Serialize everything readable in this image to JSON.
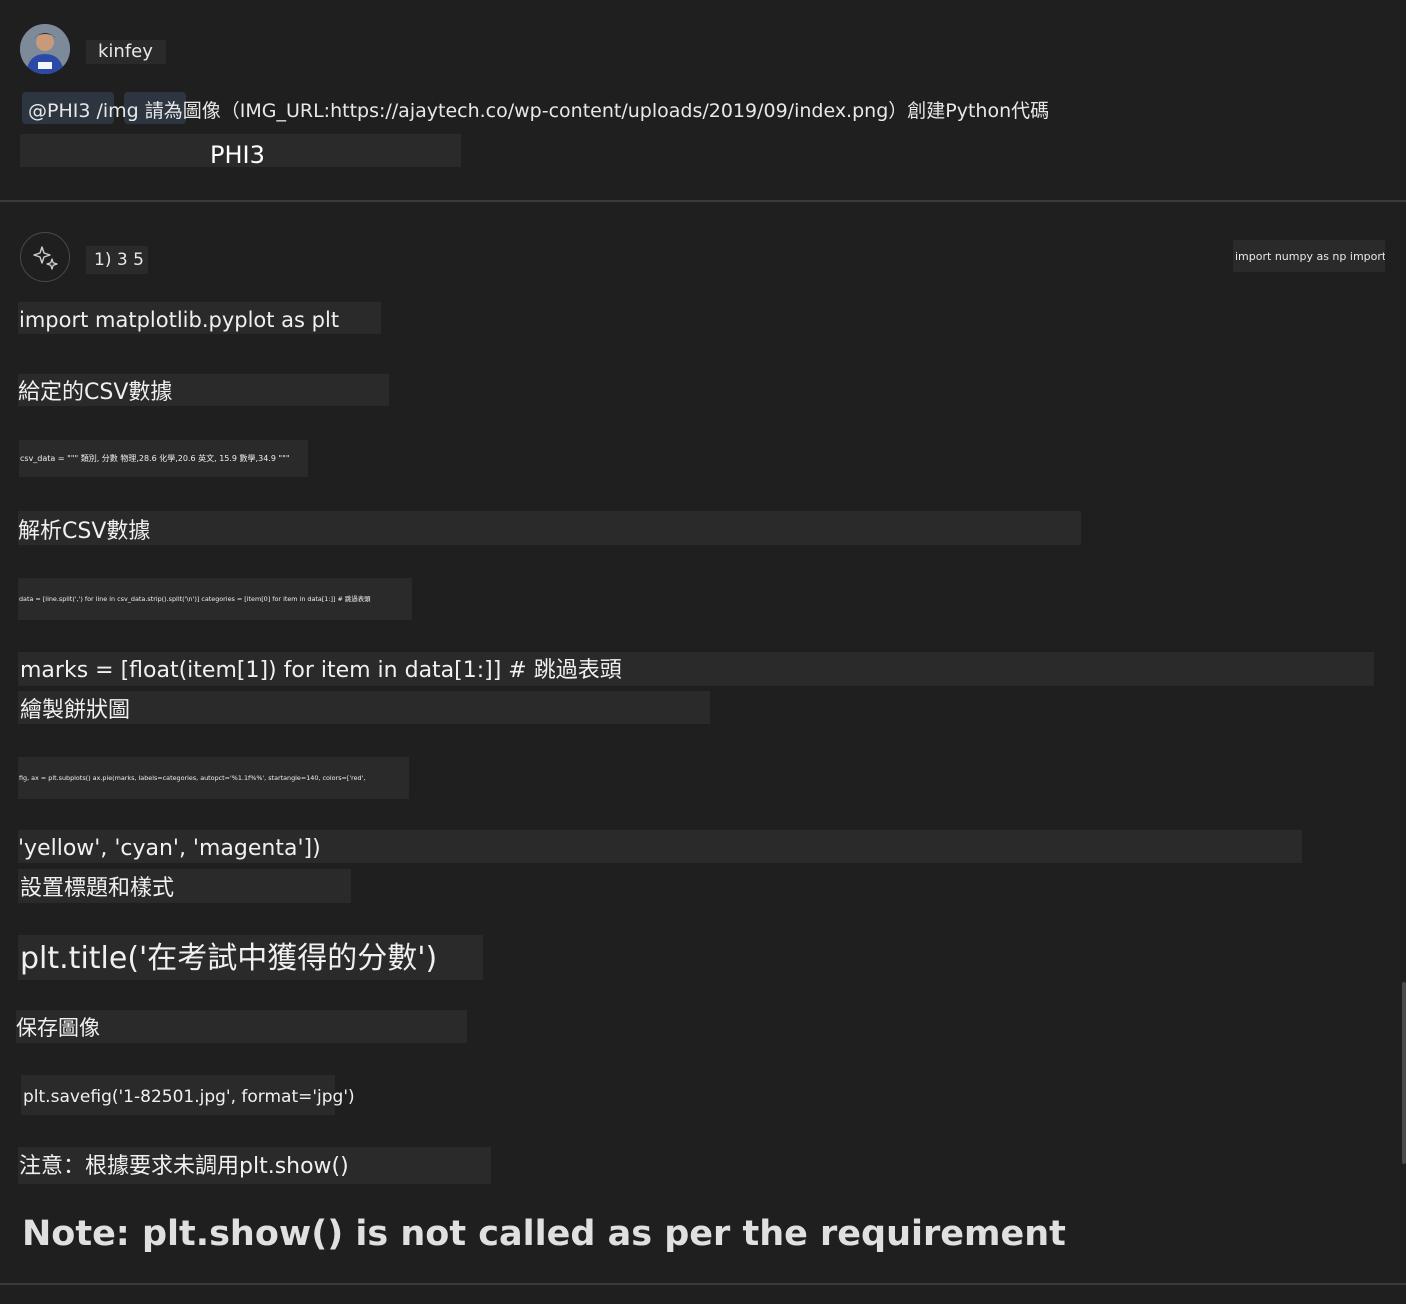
{
  "user": {
    "name": "kinfey",
    "prompt": "@PHI3 /img 請為圖像（IMG_URL:https://ajaytech.co/wp-content/uploads/2019/09/index.png）創建Python代碼",
    "agent": "PHI3"
  },
  "response": {
    "header_label": "1) 3 5",
    "side_snippet": "import numpy as np import io",
    "lines": {
      "import_plt": "import matplotlib.pyplot as plt",
      "given_csv": "給定的CSV數據",
      "csv_data": "csv_data = \"\"\" 類別, 分數 物理,28.6 化學,20.6 英文, 15.9 數學,34.9 \"\"\"",
      "parse_csv": "解析CSV數據",
      "data_line": "data = [line.split(',') for line in csv_data.strip().split('\\n')] categories = [item[0] for item in data[1:]] # 跳過表頭",
      "marks": "marks = [float(item[1]) for item in data[1:]] # 跳過表頭",
      "draw_pie": "繪製餅狀圖",
      "subplots": "fig, ax = plt.subplots() ax.pie(marks, labels=categories, autopct='%1.1f%%', startangle=140, colors=['red',",
      "colors_tail": "'yellow', 'cyan', 'magenta'])",
      "set_title": "設置標題和樣式",
      "title_call": "plt.title('在考試中獲得的分數')",
      "save_image": "保存圖像",
      "savefig": "plt.savefig('1-82501.jpg', format='jpg')",
      "note_zh": "注意：根據要求未調用plt.show()",
      "note_en": "Note: plt.show() is not called as per the requirement"
    }
  }
}
